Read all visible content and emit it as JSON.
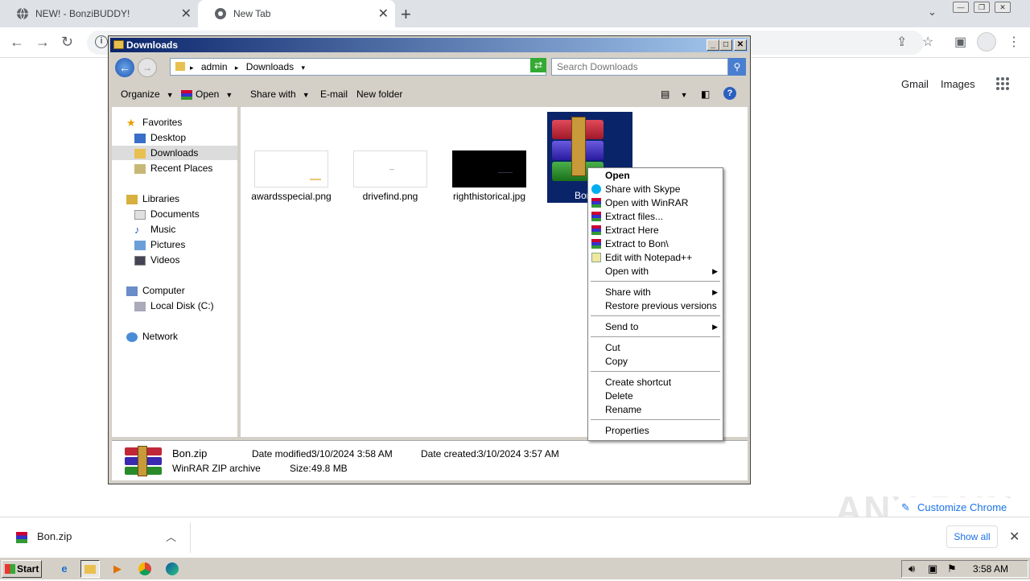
{
  "browser": {
    "tabs": [
      {
        "label": "NEW! - BonziBUDDY!"
      },
      {
        "label": "New Tab"
      }
    ],
    "newtab_glyph": "+",
    "links": {
      "gmail": "Gmail",
      "images": "Images"
    },
    "customize_label": "Customize Chrome",
    "watermark": "ANY RUN",
    "download": {
      "filename": "Bon.zip",
      "show_all": "Show all"
    }
  },
  "explorer": {
    "title": "Downloads",
    "breadcrumb": [
      "admin",
      "Downloads"
    ],
    "search_placeholder": "Search Downloads",
    "commands": {
      "organize": "Organize",
      "open": "Open",
      "share_with": "Share with",
      "email": "E-mail",
      "new_folder": "New folder"
    },
    "nav": {
      "favorites": "Favorites",
      "desktop": "Desktop",
      "downloads": "Downloads",
      "recent_places": "Recent Places",
      "libraries": "Libraries",
      "documents": "Documents",
      "music": "Music",
      "pictures": "Pictures",
      "videos": "Videos",
      "computer": "Computer",
      "local_disk": "Local Disk (C:)",
      "network": "Network"
    },
    "files": [
      {
        "name": "awardsspecial.png"
      },
      {
        "name": "drivefind.png"
      },
      {
        "name": "righthistorical.jpg"
      },
      {
        "name": "Bon"
      }
    ],
    "details": {
      "name": "Bon.zip",
      "type": "WinRAR ZIP archive",
      "modified_label": "Date modified:",
      "modified": "3/10/2024 3:58 AM",
      "created_label": "Date created:",
      "created": "3/10/2024 3:57 AM",
      "size_label": "Size:",
      "size": "49.8 MB"
    }
  },
  "context_menu": {
    "items": [
      "Open",
      "Share with Skype",
      "Open with WinRAR",
      "Extract files...",
      "Extract Here",
      "Extract to Bon\\",
      "Edit with Notepad++",
      "Open with",
      "Share with",
      "Restore previous versions",
      "Send to",
      "Cut",
      "Copy",
      "Create shortcut",
      "Delete",
      "Rename",
      "Properties"
    ]
  },
  "taskbar": {
    "start": "Start",
    "clock": "3:58 AM"
  },
  "colors": {
    "selection": "#0a246a",
    "titlebar": "#0a246a",
    "accent": "#1a73e8"
  }
}
